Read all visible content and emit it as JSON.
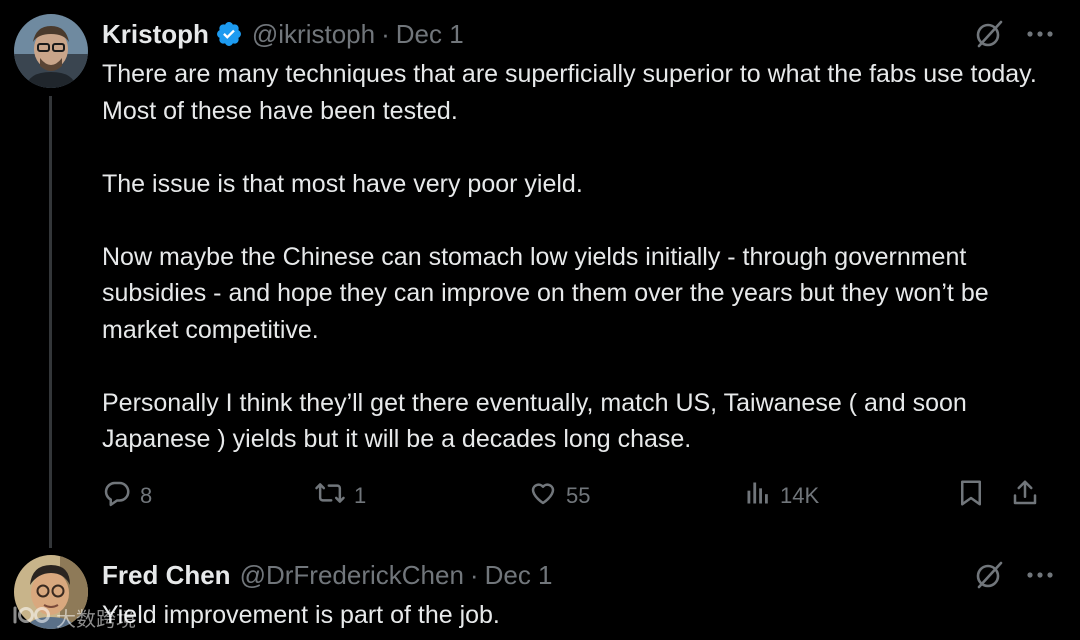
{
  "tweets": [
    {
      "author": "Kristoph",
      "handle": "@ikristoph",
      "separator": "·",
      "date": "Dec 1",
      "verified": true,
      "paragraphs": [
        "There are many techniques that are superficially superior to what the fabs use today. Most of these have been tested.",
        "The issue is that most have very poor yield.",
        "Now maybe the Chinese can stomach low yields initially - through government subsidies - and hope they can improve on them over the years but they won’t be market competitive.",
        "Personally I think they’ll get there eventually, match US, Taiwanese ( and soon Japanese ) yields but it will be a decades long chase."
      ],
      "stats": {
        "replies": "8",
        "reposts": "1",
        "likes": "55",
        "views": "14K"
      }
    },
    {
      "author": "Fred Chen",
      "handle": "@DrFrederickChen",
      "separator": "·",
      "date": "Dec 1",
      "verified": false,
      "paragraphs": [
        "Yield improvement is part of the job."
      ]
    }
  ],
  "icons": {
    "verified": "verified-badge-icon",
    "grok": "grok-icon",
    "more": "more-icon",
    "reply": "reply-icon",
    "repost": "repost-icon",
    "like": "heart-icon",
    "views": "views-icon",
    "bookmark": "bookmark-icon",
    "share": "share-icon"
  },
  "watermark": {
    "text": "大数跨境"
  },
  "colors": {
    "background": "#000000",
    "text": "#e7e9ea",
    "secondary": "#71767b",
    "verified": "#1d9bf0",
    "thread_line": "#333639"
  }
}
